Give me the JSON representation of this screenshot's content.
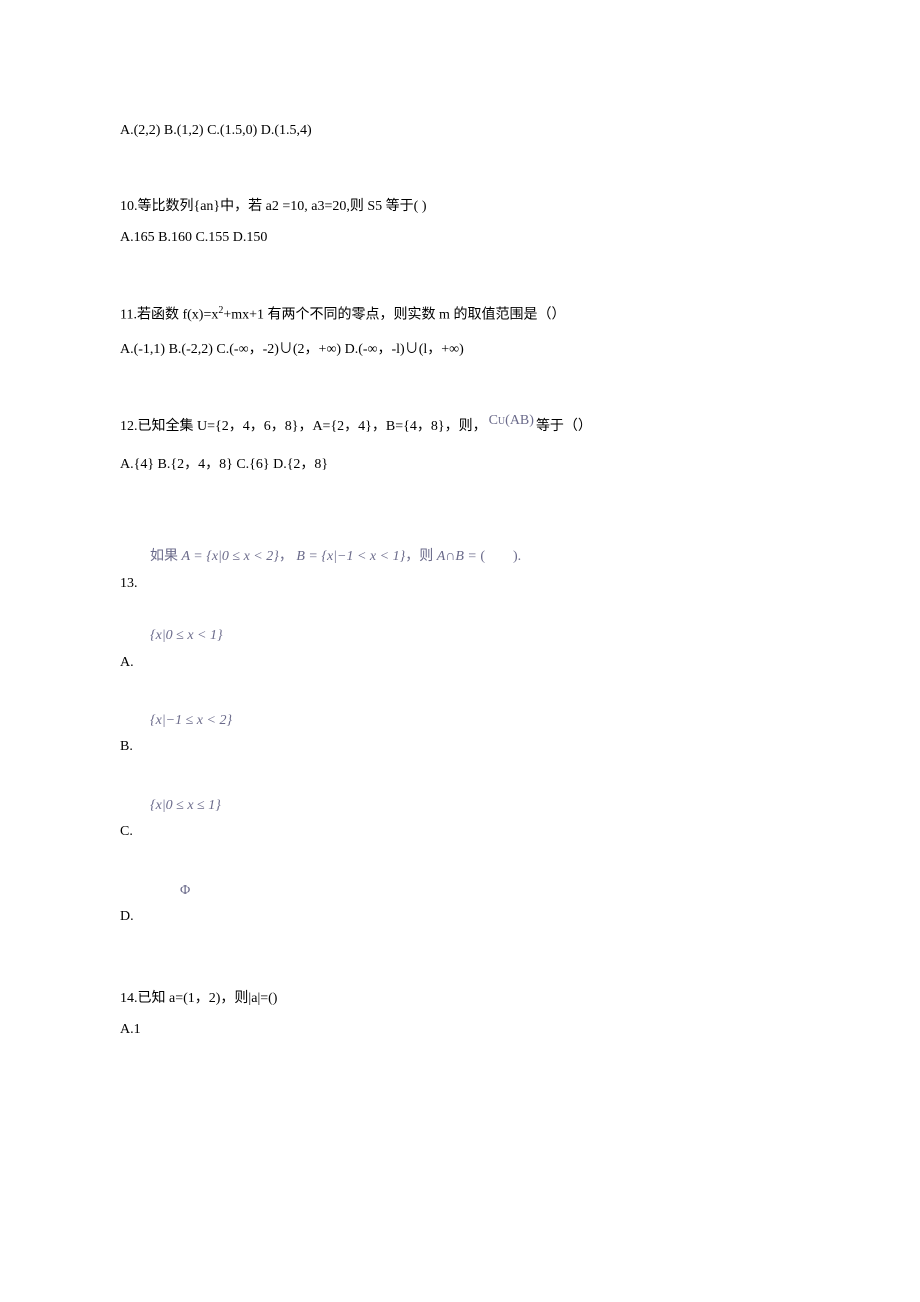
{
  "q9": {
    "options": "A.(2,2) B.(1,2) C.(1.5,0) D.(1.5,4)"
  },
  "q10": {
    "stem": "10.等比数列{an}中，若 a2 =10, a3=20,则 S5 等于( )",
    "options": "A.165 B.160 C.155 D.150"
  },
  "q11": {
    "stem_prefix": "11.若函数 f(x)=x",
    "stem_exp": "2",
    "stem_suffix": "+mx+1 有两个不同的零点，则实数 m 的取值范围是（）",
    "options": "A.(-1,1) B.(-2,2) C.(-∞，-2)∪(2，+∞) D.(-∞，-l)∪(l，+∞)"
  },
  "q12": {
    "stem_prefix": "12.已知全集 U={2，4，6，8}，A={2，4}，B={4，8}，则，",
    "complement": "Cᴜ(AB)",
    "stem_suffix": "等于（）",
    "options": "A.{4} B.{2，4，8} C.{6} D.{2，8}"
  },
  "q13": {
    "stem_cn1": "如果 ",
    "stem_math1": "A = {x|0 ≤ x < 2}",
    "stem_sep1": "，  ",
    "stem_math2": "B = {x|−1 < x < 1}",
    "stem_sep2": "，",
    "stem_cn2": "则 ",
    "stem_math3": "A∩B =",
    "stem_tail": " (　　).",
    "label": "13.",
    "optA_math": "{x|0 ≤ x < 1}",
    "optA_label": "A.",
    "optB_math": "{x|−1 ≤ x < 2}",
    "optB_label": "B.",
    "optC_math": "{x|0 ≤ x ≤ 1}",
    "optC_label": "C.",
    "optD_math": "Φ",
    "optD_label": "D."
  },
  "q14": {
    "stem": "14.已知 a=(1，2)，则|a|=()",
    "optA": "A.1"
  }
}
